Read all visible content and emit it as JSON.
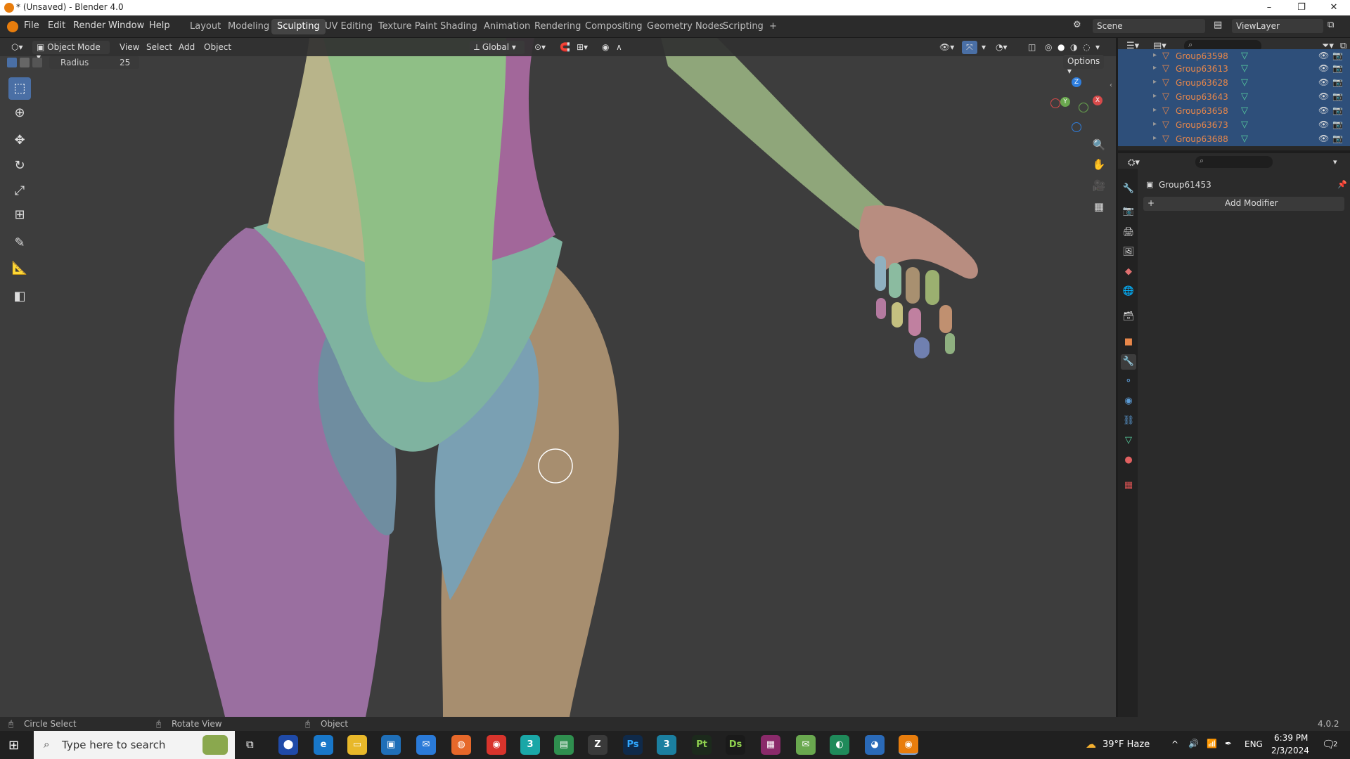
{
  "window": {
    "title": "* (Unsaved) - Blender 4.0",
    "controls": [
      "–",
      "❐",
      "✕"
    ]
  },
  "menu": {
    "items": [
      "File",
      "Edit",
      "Render",
      "Window",
      "Help"
    ]
  },
  "workspaces": {
    "tabs": [
      "Layout",
      "Modeling",
      "Sculpting",
      "UV Editing",
      "Texture Paint",
      "Shading",
      "Animation",
      "Rendering",
      "Compositing",
      "Geometry Nodes",
      "Scripting"
    ],
    "active": "Sculpting",
    "add": "+"
  },
  "scene": {
    "scene_name": "Scene",
    "view_layer": "ViewLayer"
  },
  "viewport_header": {
    "mode": "Object Mode",
    "menus": [
      "View",
      "Select",
      "Add",
      "Object"
    ],
    "orientation": "Global",
    "options_label": "Options"
  },
  "tool_settings": {
    "radius_label": "Radius",
    "radius_value": "25"
  },
  "gizmo": {
    "z": "Z",
    "y": "Y",
    "x": "X"
  },
  "outliner": {
    "rows": [
      {
        "name": "Group63598"
      },
      {
        "name": "Group63613"
      },
      {
        "name": "Group63628"
      },
      {
        "name": "Group63643"
      },
      {
        "name": "Group63658"
      },
      {
        "name": "Group63673"
      },
      {
        "name": "Group63688"
      }
    ]
  },
  "properties": {
    "object_name": "Group61453",
    "add_modifier": "Add Modifier"
  },
  "statusbar": {
    "left_action": "Circle Select",
    "middle_action": "Rotate View",
    "right_action": "Object",
    "version": "4.0.2"
  },
  "taskbar": {
    "search_placeholder": "Type here to search",
    "weather": "39°F  Haze",
    "language": "ENG",
    "time": "6:39 PM",
    "date": "2/3/2024",
    "notifications": "2",
    "apps": [
      {
        "label": "Ps",
        "color": "#0f2a4a"
      },
      {
        "label": "3",
        "color": "#1b7fa0"
      },
      {
        "label": "Pt",
        "color": "#1c2a1c"
      },
      {
        "label": "Ds",
        "color": "#1a1a1a"
      }
    ]
  },
  "colors": {
    "accent": "#4a6fa5",
    "outliner_selected": "#2e4f7a",
    "object_name": "#e8874a",
    "blender_orange": "#e87d0d"
  }
}
